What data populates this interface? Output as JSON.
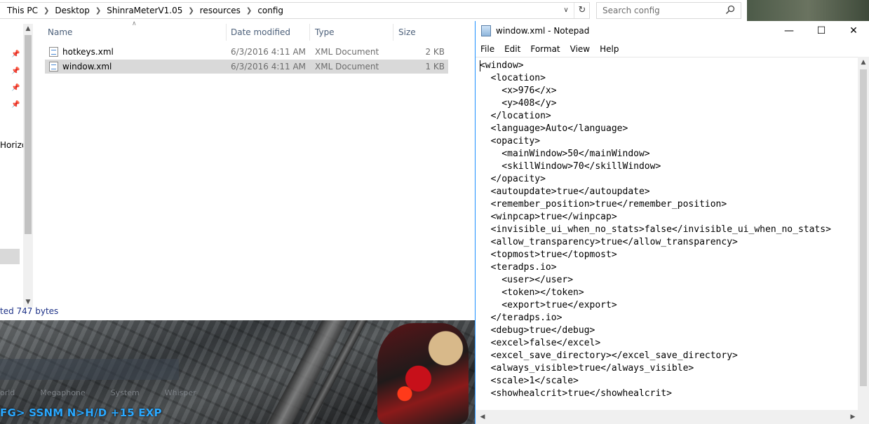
{
  "explorer": {
    "breadcrumb": [
      "This PC",
      "Desktop",
      "ShinraMeterV1.05",
      "resources",
      "config"
    ],
    "search": {
      "placeholder": "Search config"
    },
    "nav": {
      "partial_label": "Horizo"
    },
    "columns": {
      "name": "Name",
      "date": "Date modified",
      "type": "Type",
      "size": "Size"
    },
    "files": [
      {
        "name": "hotkeys.xml",
        "date": "6/3/2016 4:11 AM",
        "type": "XML Document",
        "size": "2 KB",
        "selected": false
      },
      {
        "name": "window.xml",
        "date": "6/3/2016 4:11 AM",
        "type": "XML Document",
        "size": "1 KB",
        "selected": true
      }
    ],
    "status": "ted  747 bytes"
  },
  "notepad": {
    "title": "window.xml - Notepad",
    "menu": [
      "File",
      "Edit",
      "Format",
      "View",
      "Help"
    ],
    "lines": [
      "<window>",
      "  <location>",
      "    <x>976</x>",
      "    <y>408</y>",
      "  </location>",
      "  <language>Auto</language>",
      "  <opacity>",
      "    <mainWindow>50</mainWindow>",
      "    <skillWindow>70</skillWindow>",
      "  </opacity>",
      "  <autoupdate>true</autoupdate>",
      "  <remember_position>true</remember_position>",
      "  <winpcap>true</winpcap>",
      "  <invisible_ui_when_no_stats>false</invisible_ui_when_no_stats>",
      "  <allow_transparency>true</allow_transparency>",
      "  <topmost>true</topmost>",
      "  <teradps.io>",
      "    <user></user>",
      "    <token></token>",
      "    <export>true</export>",
      "  </teradps.io>",
      "  <debug>true</debug>",
      "  <excel>false</excel>",
      "  <excel_save_directory></excel_save_directory>",
      "  <always_visible>true</always_visible>",
      "  <scale>1</scale>",
      "  <showhealcrit>true</showhealcrit>"
    ]
  },
  "game": {
    "chat_tabs": [
      "orld",
      "Megaphone",
      "System",
      "Whisper"
    ],
    "chat_line": "FG> SSNM N>H/D +15 EXP"
  }
}
